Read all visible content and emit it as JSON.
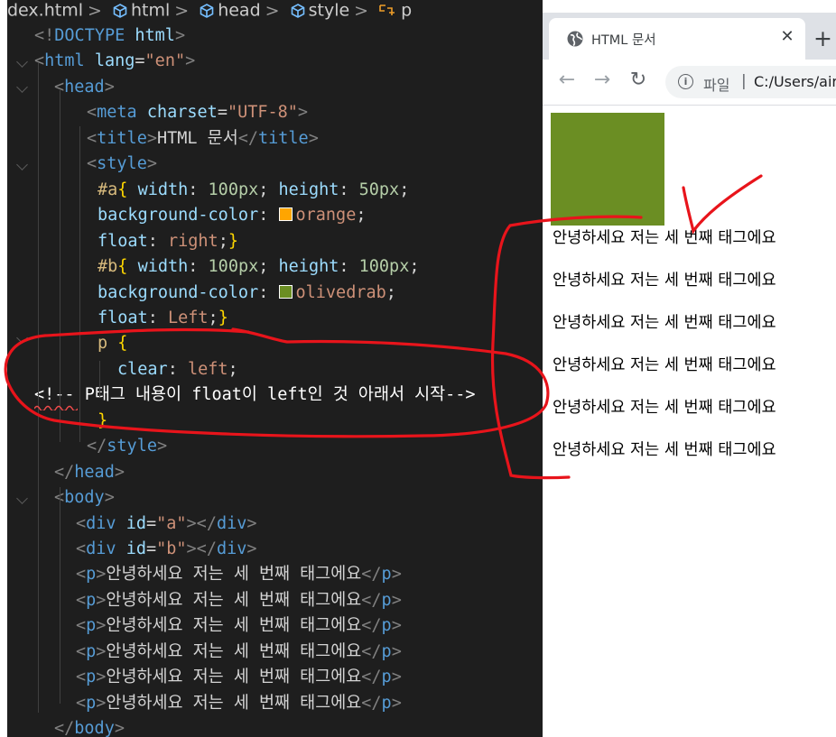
{
  "editor": {
    "breadcrumb": [
      "dex.html",
      "html",
      "head",
      "style",
      "p"
    ],
    "code_lines": [
      {
        "parts": [
          [
            "t-punct",
            "<!"
          ],
          [
            "t-tag",
            "DOCTYPE"
          ],
          [
            "t-text",
            " "
          ],
          [
            "t-attr",
            "html"
          ],
          [
            "t-punct",
            ">"
          ]
        ]
      },
      {
        "parts": [
          [
            "t-punct",
            "<"
          ],
          [
            "t-tag",
            "html"
          ],
          [
            "t-text",
            " "
          ],
          [
            "t-attr",
            "lang"
          ],
          [
            "t-text",
            "="
          ],
          [
            "t-str",
            "\"en\""
          ],
          [
            "t-punct",
            ">"
          ]
        ]
      },
      {
        "parts": [
          [
            "t-punct",
            "<"
          ],
          [
            "t-tag",
            "head"
          ],
          [
            "t-punct",
            ">"
          ]
        ]
      },
      {
        "parts": [
          [
            "t-punct",
            "<"
          ],
          [
            "t-tag",
            "meta"
          ],
          [
            "t-text",
            " "
          ],
          [
            "t-attr",
            "charset"
          ],
          [
            "t-text",
            "="
          ],
          [
            "t-str",
            "\"UTF-8\""
          ],
          [
            "t-punct",
            ">"
          ]
        ]
      },
      {
        "parts": [
          [
            "t-punct",
            "<"
          ],
          [
            "t-tag",
            "title"
          ],
          [
            "t-punct",
            ">"
          ],
          [
            "t-text",
            "HTML 문서"
          ],
          [
            "t-punct",
            "</"
          ],
          [
            "t-tag",
            "title"
          ],
          [
            "t-punct",
            ">"
          ]
        ]
      },
      {
        "parts": [
          [
            "t-punct",
            "<"
          ],
          [
            "t-tag",
            "style"
          ],
          [
            "t-punct",
            ">"
          ]
        ]
      },
      {
        "parts": [
          [
            "t-sel",
            "#a"
          ],
          [
            "t-brace",
            "{"
          ],
          [
            "t-text",
            " "
          ],
          [
            "t-prop",
            "width"
          ],
          [
            "t-text",
            ": "
          ],
          [
            "t-num",
            "100px"
          ],
          [
            "t-text",
            "; "
          ],
          [
            "t-prop",
            "height"
          ],
          [
            "t-text",
            ": "
          ],
          [
            "t-num",
            "50px"
          ],
          [
            "t-text",
            ";"
          ]
        ]
      },
      {
        "parts": [
          [
            "t-prop",
            "background-color"
          ],
          [
            "t-text",
            ": "
          ],
          [
            "swatch",
            "#ffa500"
          ],
          [
            "t-val",
            "orange"
          ],
          [
            "t-text",
            ";"
          ]
        ]
      },
      {
        "parts": [
          [
            "t-prop",
            "float"
          ],
          [
            "t-text",
            ": "
          ],
          [
            "t-val",
            "right"
          ],
          [
            "t-text",
            ";"
          ],
          [
            "t-brace",
            "}"
          ]
        ]
      },
      {
        "parts": [
          [
            "t-sel",
            "#b"
          ],
          [
            "t-brace",
            "{"
          ],
          [
            "t-text",
            " "
          ],
          [
            "t-prop",
            "width"
          ],
          [
            "t-text",
            ": "
          ],
          [
            "t-num",
            "100px"
          ],
          [
            "t-text",
            "; "
          ],
          [
            "t-prop",
            "height"
          ],
          [
            "t-text",
            ": "
          ],
          [
            "t-num",
            "100px"
          ],
          [
            "t-text",
            ";"
          ]
        ]
      },
      {
        "parts": [
          [
            "t-prop",
            "background-color"
          ],
          [
            "t-text",
            ": "
          ],
          [
            "swatch",
            "#6b8e23"
          ],
          [
            "t-val",
            "olivedrab"
          ],
          [
            "t-text",
            ";"
          ]
        ]
      },
      {
        "parts": [
          [
            "t-prop",
            "float"
          ],
          [
            "t-text",
            ": "
          ],
          [
            "t-val",
            "Left"
          ],
          [
            "t-text",
            ";"
          ],
          [
            "t-brace",
            "}"
          ]
        ]
      },
      {
        "parts": [
          [
            "t-sel",
            "p"
          ],
          [
            "t-text",
            " "
          ],
          [
            "t-brace",
            "{"
          ]
        ]
      },
      {
        "parts": [
          [
            "t-prop",
            "clear"
          ],
          [
            "t-text",
            ": "
          ],
          [
            "t-val",
            "left"
          ],
          [
            "t-text",
            ";"
          ]
        ]
      },
      {
        "parts": [
          [
            "t-cmt",
            "<!-- P태그 내용이 float이 left인 것 아래서 시작-->"
          ]
        ]
      },
      {
        "parts": [
          [
            "t-brace",
            "}"
          ]
        ]
      },
      {
        "parts": [
          [
            "t-punct",
            "</"
          ],
          [
            "t-tag",
            "style"
          ],
          [
            "t-punct",
            ">"
          ]
        ]
      },
      {
        "parts": [
          [
            "t-punct",
            "</"
          ],
          [
            "t-tag",
            "head"
          ],
          [
            "t-punct",
            ">"
          ]
        ]
      },
      {
        "parts": [
          [
            "t-punct",
            "<"
          ],
          [
            "t-tag",
            "body"
          ],
          [
            "t-punct",
            ">"
          ]
        ]
      },
      {
        "parts": [
          [
            "t-punct",
            "<"
          ],
          [
            "t-tag",
            "div"
          ],
          [
            "t-text",
            " "
          ],
          [
            "t-attr",
            "id"
          ],
          [
            "t-text",
            "="
          ],
          [
            "t-str",
            "\"a\""
          ],
          [
            "t-punct",
            "></"
          ],
          [
            "t-tag",
            "div"
          ],
          [
            "t-punct",
            ">"
          ]
        ]
      },
      {
        "parts": [
          [
            "t-punct",
            "<"
          ],
          [
            "t-tag",
            "div"
          ],
          [
            "t-text",
            " "
          ],
          [
            "t-attr",
            "id"
          ],
          [
            "t-text",
            "="
          ],
          [
            "t-str",
            "\"b\""
          ],
          [
            "t-punct",
            "></"
          ],
          [
            "t-tag",
            "div"
          ],
          [
            "t-punct",
            ">"
          ]
        ]
      },
      {
        "parts": [
          [
            "t-punct",
            "<"
          ],
          [
            "t-tag",
            "p"
          ],
          [
            "t-punct",
            ">"
          ],
          [
            "t-text",
            "안녕하세요 저는 세 번째 태그에요"
          ],
          [
            "t-punct",
            "</"
          ],
          [
            "t-tag",
            "p"
          ],
          [
            "t-punct",
            ">"
          ]
        ]
      },
      {
        "parts": [
          [
            "t-punct",
            "<"
          ],
          [
            "t-tag",
            "p"
          ],
          [
            "t-punct",
            ">"
          ],
          [
            "t-text",
            "안녕하세요 저는 세 번째 태그에요"
          ],
          [
            "t-punct",
            "</"
          ],
          [
            "t-tag",
            "p"
          ],
          [
            "t-punct",
            ">"
          ]
        ]
      },
      {
        "parts": [
          [
            "t-punct",
            "<"
          ],
          [
            "t-tag",
            "p"
          ],
          [
            "t-punct",
            ">"
          ],
          [
            "t-text",
            "안녕하세요 저는 세 번째 태그에요"
          ],
          [
            "t-punct",
            "</"
          ],
          [
            "t-tag",
            "p"
          ],
          [
            "t-punct",
            ">"
          ]
        ]
      },
      {
        "parts": [
          [
            "t-punct",
            "<"
          ],
          [
            "t-tag",
            "p"
          ],
          [
            "t-punct",
            ">"
          ],
          [
            "t-text",
            "안녕하세요 저는 세 번째 태그에요"
          ],
          [
            "t-punct",
            "</"
          ],
          [
            "t-tag",
            "p"
          ],
          [
            "t-punct",
            ">"
          ]
        ]
      },
      {
        "parts": [
          [
            "t-punct",
            "<"
          ],
          [
            "t-tag",
            "p"
          ],
          [
            "t-punct",
            ">"
          ],
          [
            "t-text",
            "안녕하세요 저는 세 번째 태그에요"
          ],
          [
            "t-punct",
            "</"
          ],
          [
            "t-tag",
            "p"
          ],
          [
            "t-punct",
            ">"
          ]
        ]
      },
      {
        "parts": [
          [
            "t-punct",
            "<"
          ],
          [
            "t-tag",
            "p"
          ],
          [
            "t-punct",
            ">"
          ],
          [
            "t-text",
            "안녕하세요 저는 세 번째 태그에요"
          ],
          [
            "t-punct",
            "</"
          ],
          [
            "t-tag",
            "p"
          ],
          [
            "t-punct",
            ">"
          ]
        ]
      },
      {
        "parts": [
          [
            "t-punct",
            "</"
          ],
          [
            "t-tag",
            "body"
          ],
          [
            "t-punct",
            ">"
          ]
        ]
      }
    ]
  },
  "browser": {
    "tab_title": "HTML 문서",
    "tab_close": "✕",
    "new_tab": "+",
    "back_icon": "←",
    "forward_icon": "→",
    "reload_icon": "↻",
    "info_icon": "i",
    "omnibox_scheme": "파일",
    "omnibox_sep": "|",
    "omnibox_url": "C:/Users/air",
    "box_b_color": "#6b8e23",
    "paragraphs": [
      "안녕하세요 저는 세 번째 태그에요",
      "안녕하세요 저는 세 번째 태그에요",
      "안녕하세요 저는 세 번째 태그에요",
      "안녕하세요 저는 세 번째 태그에요",
      "안녕하세요 저는 세 번째 태그에요",
      "안녕하세요 저는 세 번째 태그에요"
    ]
  },
  "annotation_color": "#e8141b"
}
